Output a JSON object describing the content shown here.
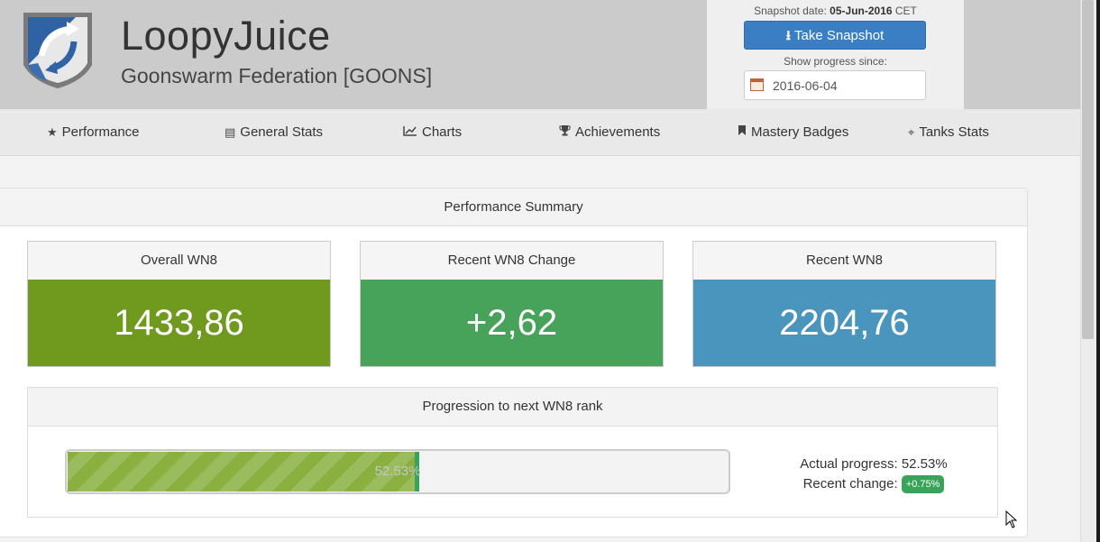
{
  "header": {
    "player_name": "LoopyJuice",
    "clan_name": "Goonswarm Federation [GOONS]",
    "logo_icon": "goons-banner-logo"
  },
  "snapshot": {
    "date_label": "Snapshot date:",
    "date_value": "05-Jun-2016",
    "timezone": "CET",
    "button_label": "Take Snapshot",
    "since_label": "Show progress since:",
    "since_value": "2016-06-04"
  },
  "nav": [
    {
      "label": "Performance",
      "icon": "star-icon"
    },
    {
      "label": "General Stats",
      "icon": "list-icon"
    },
    {
      "label": "Charts",
      "icon": "line-chart-icon"
    },
    {
      "label": "Achievements",
      "icon": "trophy-icon"
    },
    {
      "label": "Mastery Badges",
      "icon": "bookmark-icon"
    },
    {
      "label": "Tanks Stats",
      "icon": "crosshair-icon"
    }
  ],
  "summary": {
    "title": "Performance Summary",
    "cards": [
      {
        "title": "Overall WN8",
        "value": "1433,86",
        "color": "#6f9a1e"
      },
      {
        "title": "Recent WN8 Change",
        "value": "+2,62",
        "color": "#47a35a"
      },
      {
        "title": "Recent WN8",
        "value": "2204,76",
        "color": "#4a95be"
      }
    ]
  },
  "progression": {
    "title": "Progression to next WN8 rank",
    "percent": 52.53,
    "bar_text": "52.53%",
    "actual_label": "Actual progress: 52.53%",
    "recent_label": "Recent change:",
    "recent_value": "+0.75%"
  }
}
